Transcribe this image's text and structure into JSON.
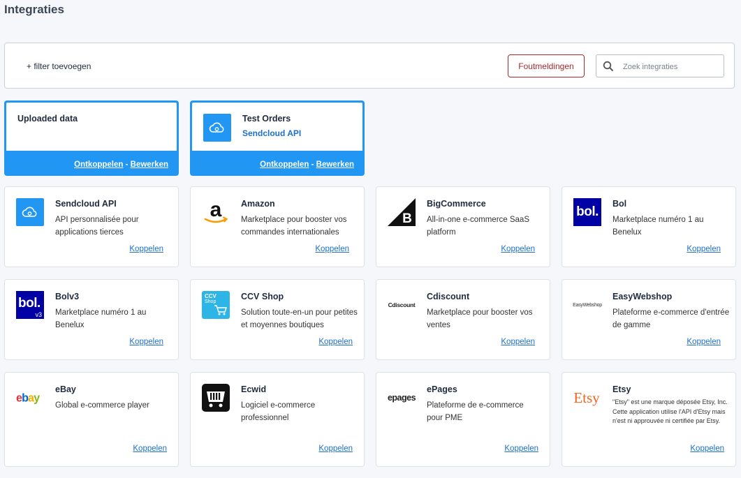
{
  "page": {
    "title": "Integraties"
  },
  "filter_bar": {
    "add_filter": "+ filter toevoegen",
    "errors_button": "Foutmeldingen",
    "search_placeholder": "Zoek integraties"
  },
  "connected": [
    {
      "name": "Uploaded data",
      "subtitle": "",
      "unlink": "Ontkoppelen",
      "separator": "-",
      "edit": "Bewerken"
    },
    {
      "name": "Test Orders",
      "subtitle": "Sendcloud API",
      "unlink": "Ontkoppelen",
      "separator": "-",
      "edit": "Bewerken",
      "icon": "cloud-icon"
    }
  ],
  "integrations": [
    {
      "name": "Sendcloud API",
      "desc": "API personnalisée pour applications tierces",
      "link": "Koppelen",
      "icon": "sendcloud-logo"
    },
    {
      "name": "Amazon",
      "desc": "Marketplace pour booster vos commandes internationales",
      "link": "Koppelen",
      "icon": "amazon-logo"
    },
    {
      "name": "BigCommerce",
      "desc": "All-in-one e-commerce SaaS platform",
      "link": "Koppelen",
      "icon": "bigcommerce-logo"
    },
    {
      "name": "Bol",
      "desc": "Marketplace numéro 1 au Benelux",
      "link": "Koppelen",
      "icon": "bol-logo",
      "logo_text": "bol."
    },
    {
      "name": "Bolv3",
      "desc": "Marketplace numéro 1 au Benelux",
      "link": "Koppelen",
      "icon": "bolv3-logo",
      "logo_text": "bol.",
      "logo_sub": "v3"
    },
    {
      "name": "CCV Shop",
      "desc": "Solution toute-en-un pour petites et moyennes boutiques",
      "link": "Koppelen",
      "icon": "ccv-shop-logo",
      "logo_text": "CCV",
      "logo_sub": "Shop"
    },
    {
      "name": "Cdiscount",
      "desc": "Marketplace pour booster vos ventes",
      "link": "Koppelen",
      "icon": "cdiscount-logo",
      "logo_text": "Cdiscount"
    },
    {
      "name": "EasyWebshop",
      "desc": "Plateforme e-commerce d'entrée de gamme",
      "link": "Koppelen",
      "icon": "easywebshop-logo",
      "logo_text": "EasyWebshop"
    },
    {
      "name": "eBay",
      "desc": "Global e-commerce player",
      "link": "Koppelen",
      "icon": "ebay-logo"
    },
    {
      "name": "Ecwid",
      "desc": "Logiciel e-commerce professionnel",
      "link": "Koppelen",
      "icon": "ecwid-logo"
    },
    {
      "name": "ePages",
      "desc": "Plateforme de e-commerce pour PME",
      "link": "Koppelen",
      "icon": "epages-logo",
      "logo_text": "epages"
    },
    {
      "name": "Etsy",
      "desc": "\"Etsy\" est une marque déposée Etsy, Inc. Cette application utilise l'API d'Etsy mais n'est ni approuvée ni certifiée par Etsy.",
      "link": "Koppelen",
      "icon": "etsy-logo",
      "logo_text": "Etsy"
    }
  ],
  "colors": {
    "accent": "#2196f3",
    "link": "#1b70c9",
    "danger": "#a8282b"
  }
}
